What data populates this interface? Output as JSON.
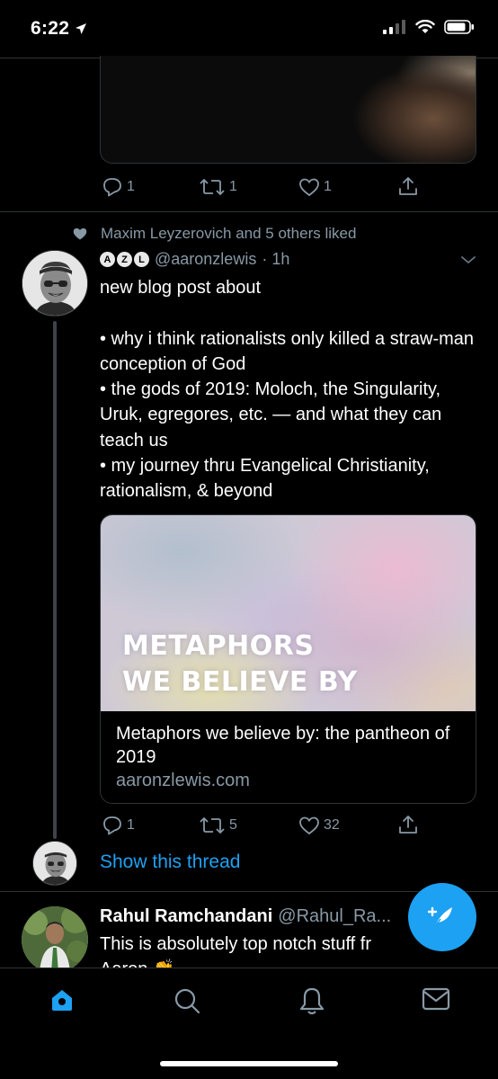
{
  "status_bar": {
    "time": "6:22"
  },
  "previous_tweet": {
    "reply_count": "1",
    "retweet_count": "1",
    "like_count": "1"
  },
  "tweet": {
    "social_context": "Maxim Leyzerovich and 5 others liked",
    "badges": [
      "A",
      "Z",
      "L"
    ],
    "handle": "@aaronzlewis",
    "time": "· 1h",
    "text": "new blog post about\n\n• why i think rationalists only killed a straw-man conception of God\n• the gods of 2019: Moloch, the Singularity, Uruk, egregores, etc. — and what they can teach us\n• my journey thru Evangelical Christianity, rationalism, & beyond",
    "card": {
      "image_title": "METAPHORS\nWE BELIEVE BY",
      "title": "Metaphors we believe by: the pantheon of 2019",
      "domain": "aaronzlewis.com"
    },
    "reply_count": "1",
    "retweet_count": "5",
    "like_count": "32",
    "show_thread": "Show this thread"
  },
  "reply_tweet": {
    "name": "Rahul Ramchandani",
    "handle": "@Rahul_Ra...",
    "text": "This is absolutely top notch stuff fr\nAaron 👏"
  },
  "colors": {
    "background": "#000000",
    "accent": "#1da1f2",
    "secondary_text": "#8899a6",
    "divider": "#2f3336"
  },
  "tabs": [
    "home-icon",
    "search-icon",
    "notifications-icon",
    "messages-icon"
  ]
}
